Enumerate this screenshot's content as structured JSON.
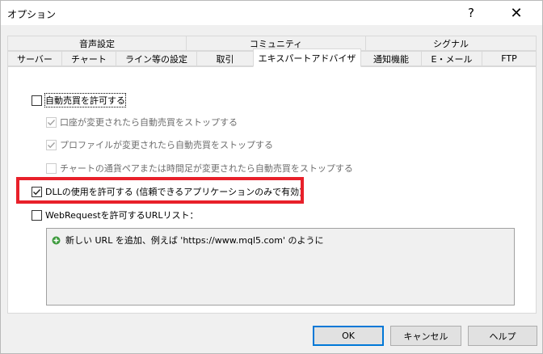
{
  "window": {
    "title": "オプション",
    "help_glyph": "?",
    "close_glyph": "✕"
  },
  "tabs": {
    "row_back": [
      "音声設定",
      "コミュニティ",
      "シグナル"
    ],
    "row_front": [
      "サーバー",
      "チャート",
      "ライン等の設定",
      "取引",
      "エキスパートアドバイザ",
      "通知機能",
      "E・メール",
      "FTP"
    ],
    "active": "エキスパートアドバイザ"
  },
  "options": {
    "allow_auto_trading": {
      "label": "自動売買を許可する",
      "checked": false
    },
    "stop_on_account_change": {
      "label": "口座が変更されたら自動売買をストップする",
      "checked": true,
      "disabled": true
    },
    "stop_on_profile_change": {
      "label": "プロファイルが変更されたら自動売買をストップする",
      "checked": true,
      "disabled": true
    },
    "stop_on_chart_change": {
      "label": "チャートの通貨ペアまたは時間足が変更されたら自動売買をストップする",
      "checked": false,
      "disabled": true
    },
    "allow_dll": {
      "label": "DLLの使用を許可する (信頼できるアプリケーションのみで有効)",
      "checked": true
    },
    "allow_webrequest": {
      "label": "WebRequestを許可するURLリスト：",
      "checked": false
    }
  },
  "url_list": {
    "add_hint": "新しい URL を追加、例えば 'https://www.mql5.com' のように"
  },
  "buttons": {
    "ok": "OK",
    "cancel": "キャンセル",
    "help": "ヘルプ"
  },
  "colors": {
    "highlight_box": "#e8202a",
    "plus_icon": "#3c9a3c"
  }
}
